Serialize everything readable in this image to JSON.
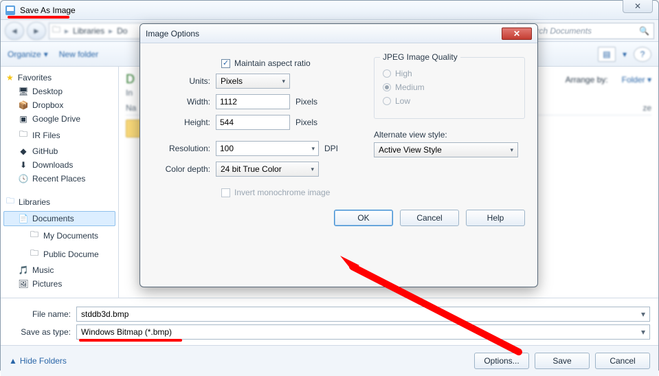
{
  "window": {
    "title": "Save As Image",
    "close_glyph": "✕",
    "nav_back_glyph": "◄",
    "nav_fwd_glyph": "►",
    "folder_glyph": "🗀",
    "breadcrumb": {
      "a": "Libraries",
      "b": "Do",
      "sep": "▸"
    },
    "search_placeholder": "Search Documents",
    "search_glyph": "🔍",
    "toolbar": {
      "organize": "Organize",
      "organize_dd": "▾",
      "newfolder": "New folder",
      "view_glyph": "▤",
      "view_dd": "▾",
      "help_glyph": "?"
    },
    "sidebar": {
      "favorites": "Favorites",
      "items_fav": [
        {
          "icon": "🖥",
          "label": "Desktop"
        },
        {
          "icon": "📦",
          "label": "Dropbox"
        },
        {
          "icon": "▣",
          "label": "Google Drive"
        },
        {
          "icon": "🗀",
          "label": "IR Files"
        },
        {
          "icon": "◆",
          "label": "GitHub"
        },
        {
          "icon": "⬇",
          "label": "Downloads"
        },
        {
          "icon": "🕓",
          "label": "Recent Places"
        }
      ],
      "libraries": "Libraries",
      "items_lib": [
        {
          "icon": "📄",
          "label": "Documents",
          "selected": true
        },
        {
          "icon": "🗀",
          "label": "My Documents",
          "sub": true
        },
        {
          "icon": "🗀",
          "label": "Public Docume",
          "sub": true
        },
        {
          "icon": "🎵",
          "label": "Music"
        },
        {
          "icon": "🖼",
          "label": "Pictures"
        }
      ]
    },
    "main": {
      "title": "D",
      "subtitle": "In",
      "name_col": "Na",
      "arrange_label": "Arrange by:",
      "arrange_value": "Folder",
      "arrange_dd": "▾",
      "size_col": "ze"
    },
    "form": {
      "filename_label": "File name:",
      "filename_value": "stddb3d.bmp",
      "type_label": "Save as type:",
      "type_value": "Windows Bitmap (*.bmp)"
    },
    "footer": {
      "hide_folders": "Hide Folders",
      "hide_glyph": "▲",
      "options": "Options...",
      "save": "Save",
      "cancel": "Cancel"
    }
  },
  "dialog": {
    "title": "Image Options",
    "close_glyph": "✕",
    "maintain_ratio": "Maintain aspect ratio",
    "units_label": "Units:",
    "units_value": "Pixels",
    "width_label": "Width:",
    "width_value": "1112",
    "width_suffix": "Pixels",
    "height_label": "Height:",
    "height_value": "544",
    "height_suffix": "Pixels",
    "resolution_label": "Resolution:",
    "resolution_value": "100",
    "resolution_suffix": "DPI",
    "depth_label": "Color depth:",
    "depth_value": "24 bit True Color",
    "invert_label": "Invert monochrome image",
    "jpeg_group": "JPEG Image Quality",
    "jpeg_high": "High",
    "jpeg_medium": "Medium",
    "jpeg_low": "Low",
    "altview_label": "Alternate view style:",
    "altview_value": "Active View Style",
    "ok": "OK",
    "cancel": "Cancel",
    "help": "Help",
    "dd": "▾"
  }
}
